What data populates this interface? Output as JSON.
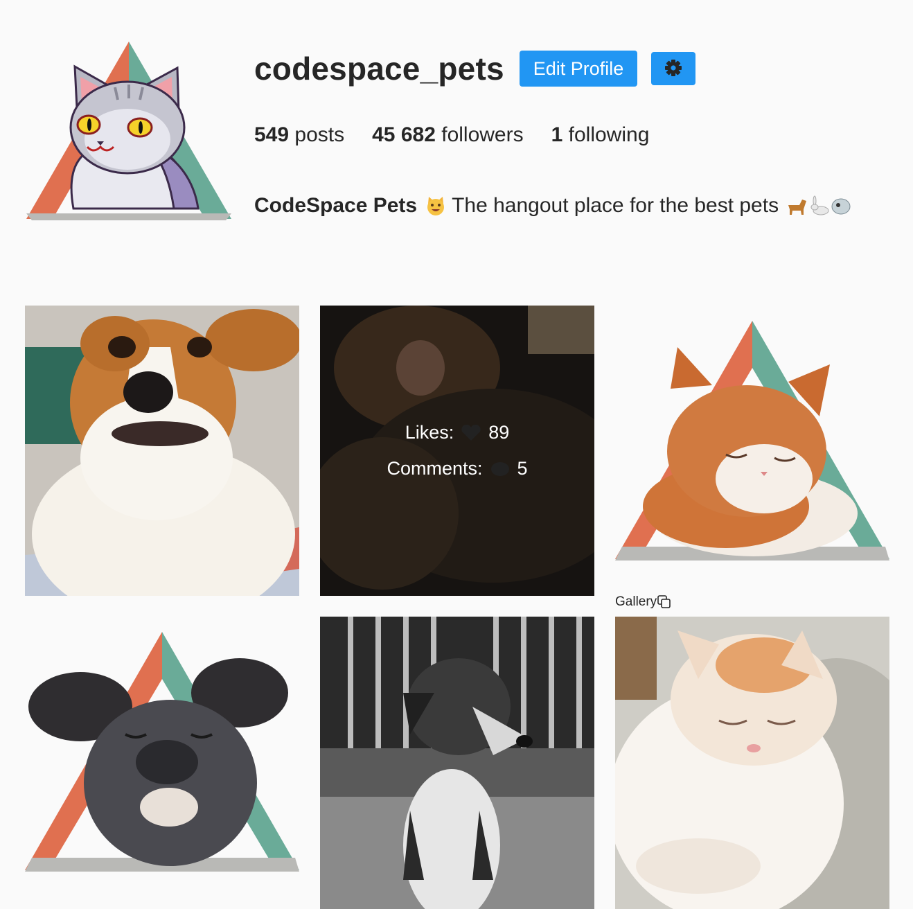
{
  "profile": {
    "username": "codespace_pets",
    "edit_label": "Edit Profile",
    "settings_icon": "gear-icon",
    "stats": {
      "posts_count": "549",
      "posts_label": "posts",
      "followers_count": "45 682",
      "followers_label": "followers",
      "following_count": "1",
      "following_label": "following"
    },
    "bio": {
      "name": "CodeSpace Pets",
      "text": "The hangout place for the best pets"
    },
    "accent_color": "#2196f3"
  },
  "posts": [
    {
      "kind": "photo",
      "subject": "dog"
    },
    {
      "kind": "photo",
      "subject": "cat",
      "hover": {
        "likes_label": "Likes:",
        "likes": "89",
        "comments_label": "Comments:",
        "comments": "5"
      }
    },
    {
      "kind": "sticker",
      "subject": "cat"
    },
    {
      "kind": "sticker",
      "subject": "dog"
    },
    {
      "kind": "photo",
      "subject": "dog"
    },
    {
      "kind": "gallery",
      "subject": "cat",
      "label": "Gallery"
    }
  ],
  "brand_colors": {
    "orange": "#e07050",
    "teal": "#6aab98",
    "gray": "#b9b9b6"
  }
}
